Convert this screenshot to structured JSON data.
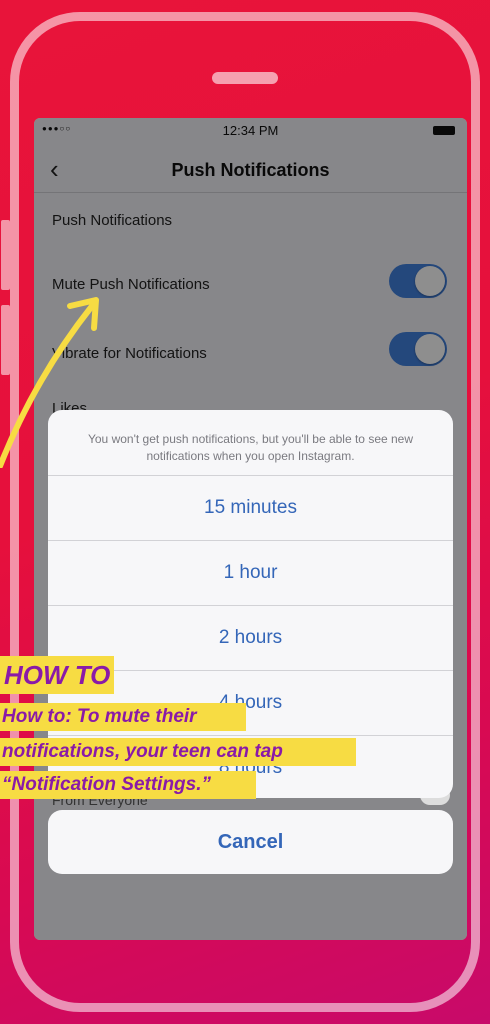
{
  "status_bar": {
    "time": "12:34 PM",
    "signal": "●●●○○"
  },
  "nav": {
    "title": "Push Notifications"
  },
  "settings": {
    "section_label": "Push Notifications",
    "mute_label": "Mute Push Notifications",
    "vibrate_label": "Vibrate for Notifications",
    "likes_label": "Likes",
    "partial_from_everyone": "From Everyone"
  },
  "action_sheet": {
    "message": "You won't get push notifications, but you'll be able to see new notifications when you open Instagram.",
    "options": [
      "15 minutes",
      "1 hour",
      "2 hours",
      "4 hours",
      "8 hours"
    ],
    "cancel": "Cancel"
  },
  "overlay_caption": {
    "title": "HOW TO",
    "line1": "How to: To mute their",
    "line2": "notifications, your teen can tap",
    "line3": "“Notification Settings.”"
  },
  "colors": {
    "accent": "#3466b8",
    "toggle": "#3f7cd6",
    "highlight": "#f7dc43",
    "caption_text": "#8a1aa8"
  }
}
